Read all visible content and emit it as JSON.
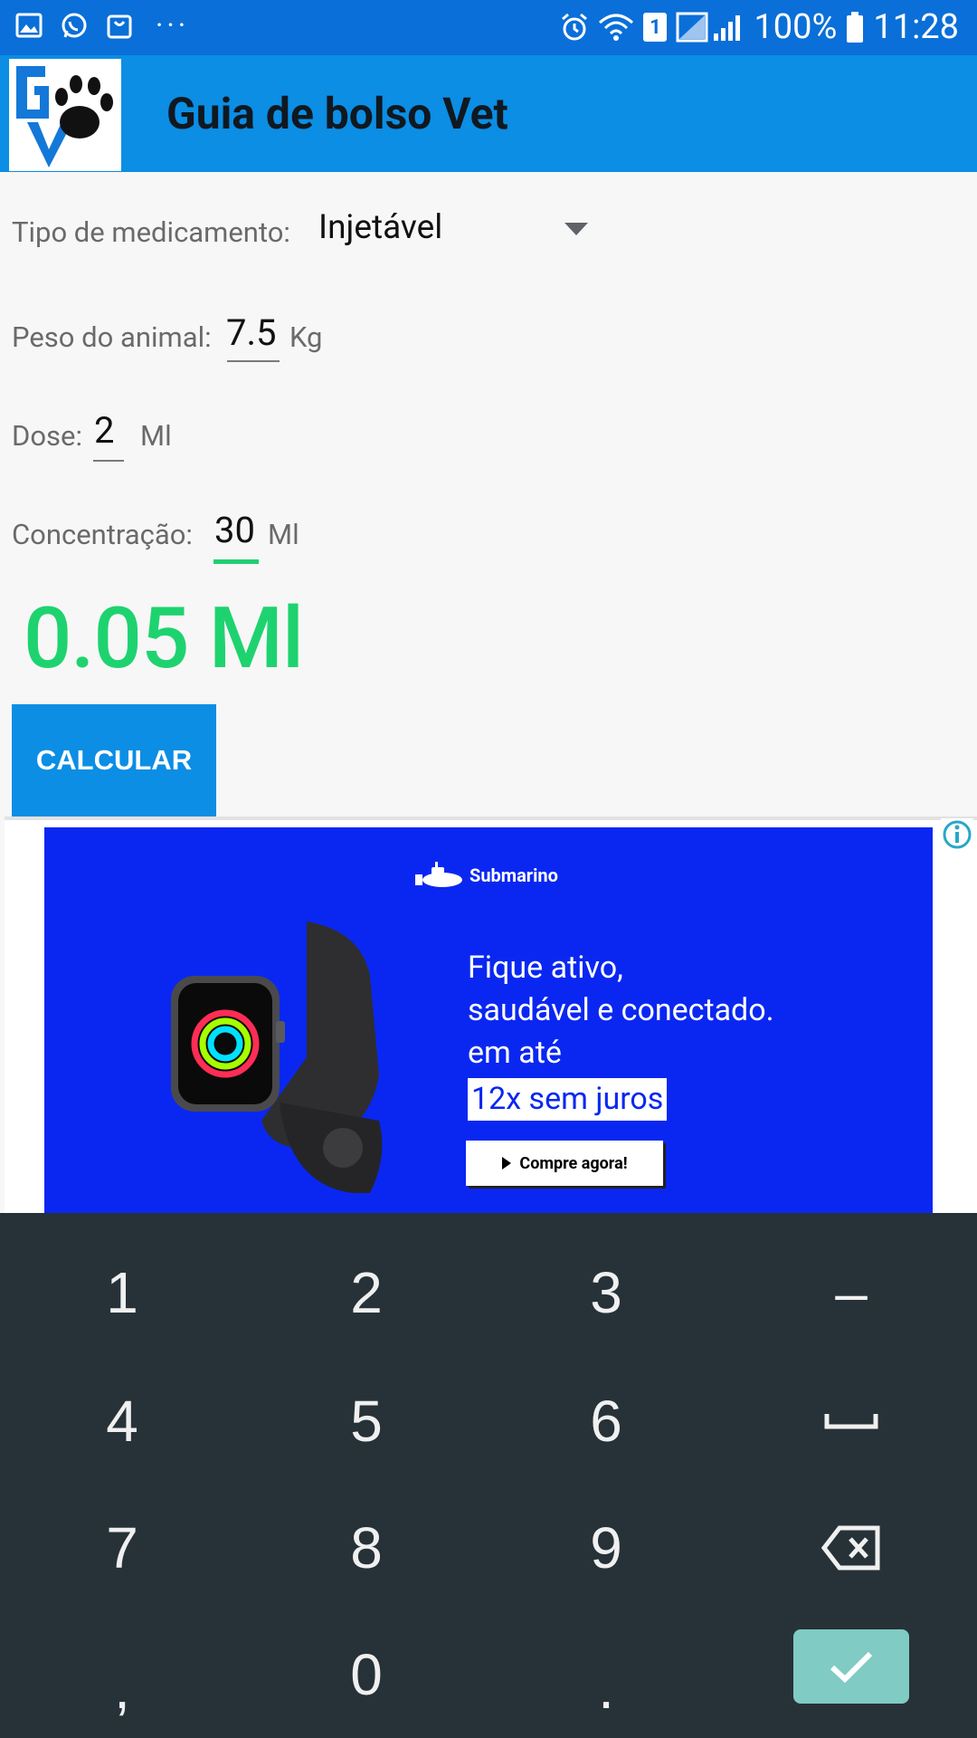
{
  "status_bar": {
    "battery_percent": "100%",
    "time": "11:28",
    "sim_badge": "1",
    "more_indicator": "···"
  },
  "app_bar": {
    "title": "Guia de bolso Vet",
    "logo_icon": "gv-paw-logo"
  },
  "form": {
    "medication_type_label": "Tipo de medicamento:",
    "medication_type_value": "Injetável",
    "weight_label": "Peso do animal:",
    "weight_value": "7.5",
    "weight_unit": "Kg",
    "dose_label": "Dose:",
    "dose_value": "2",
    "dose_unit": "Ml",
    "concentration_label": "Concentração:",
    "concentration_value": "30",
    "concentration_unit": "Ml"
  },
  "result": {
    "value": "0.05 Ml",
    "color": "#1ed36f"
  },
  "calculate_button": {
    "label": "CALCULAR"
  },
  "ad": {
    "brand": "Submarino",
    "line1": "Fique ativo,",
    "line2": "saudável e conectado.",
    "line3": "em até",
    "highlight": "12x sem juros",
    "cta": "Compre agora!",
    "background": "#0a27f2"
  },
  "keyboard": {
    "keys": [
      "1",
      "2",
      "3",
      "–",
      "4",
      "5",
      "6",
      "␣",
      "7",
      "8",
      "9",
      "⌫",
      ",",
      "0",
      "."
    ],
    "space_icon": "space-icon",
    "backspace_icon": "backspace-icon",
    "enter_icon": "check-icon",
    "enter_color": "#80cbc4"
  },
  "colors": {
    "status_bar": "#0a6fd8",
    "app_bar": "#0b8ee4",
    "keyboard_bg": "#263238"
  }
}
